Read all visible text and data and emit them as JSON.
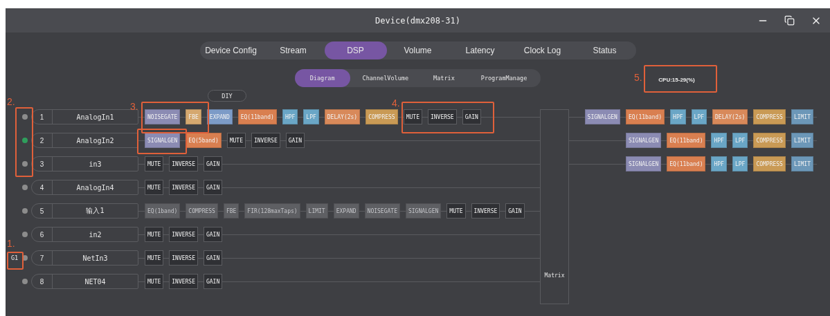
{
  "window": {
    "title": "Device(dmx208-31)"
  },
  "tabs": [
    {
      "label": "Device Config",
      "selected": false
    },
    {
      "label": "Stream",
      "selected": false
    },
    {
      "label": "DSP",
      "selected": true
    },
    {
      "label": "Volume",
      "selected": false
    },
    {
      "label": "Latency",
      "selected": false
    },
    {
      "label": "Clock Log",
      "selected": false
    },
    {
      "label": "Status",
      "selected": false
    }
  ],
  "subtabs": [
    {
      "label": "Diagram",
      "selected": true
    },
    {
      "label": "ChannelVolume",
      "selected": false
    },
    {
      "label": "Matrix",
      "selected": false
    },
    {
      "label": "ProgramManage",
      "selected": false
    }
  ],
  "cpu": "CPU:15-29(%)",
  "diy_button": "DIY",
  "channels": [
    {
      "number": "1",
      "name": "AnalogIn1",
      "active": false,
      "modules": [
        {
          "label": "NOISEGATE",
          "kind": "noisegate",
          "disabled": false
        },
        {
          "label": "FBE",
          "kind": "fbe",
          "disabled": false
        },
        {
          "label": "EXPAND",
          "kind": "expand",
          "disabled": false
        },
        {
          "label": "EQ(11band)",
          "kind": "eq",
          "disabled": false
        },
        {
          "label": "HPF",
          "kind": "filter",
          "disabled": false
        },
        {
          "label": "LPF",
          "kind": "filter",
          "disabled": false
        },
        {
          "label": "DELAY(2s)",
          "kind": "delay",
          "disabled": false
        },
        {
          "label": "COMPRESS",
          "kind": "compress",
          "disabled": false
        },
        {
          "label": "MUTE",
          "kind": "basic",
          "disabled": false
        },
        {
          "label": "INVERSE",
          "kind": "basic",
          "disabled": false
        },
        {
          "label": "GAIN",
          "kind": "basic",
          "disabled": false
        }
      ]
    },
    {
      "number": "2",
      "name": "AnalogIn2",
      "active": true,
      "modules": [
        {
          "label": "SIGNALGEN",
          "kind": "signalgen",
          "disabled": false
        },
        {
          "label": "EQ(5band)",
          "kind": "eq",
          "disabled": false
        },
        {
          "label": "MUTE",
          "kind": "basic",
          "disabled": false
        },
        {
          "label": "INVERSE",
          "kind": "basic",
          "disabled": false
        },
        {
          "label": "GAIN",
          "kind": "basic",
          "disabled": false
        }
      ]
    },
    {
      "number": "3",
      "name": "in3",
      "active": false,
      "modules": [
        {
          "label": "MUTE",
          "kind": "basic",
          "disabled": false
        },
        {
          "label": "INVERSE",
          "kind": "basic",
          "disabled": false
        },
        {
          "label": "GAIN",
          "kind": "basic",
          "disabled": false
        }
      ]
    },
    {
      "number": "4",
      "name": "AnalogIn4",
      "active": false,
      "modules": [
        {
          "label": "MUTE",
          "kind": "basic",
          "disabled": false
        },
        {
          "label": "INVERSE",
          "kind": "basic",
          "disabled": false
        },
        {
          "label": "GAIN",
          "kind": "basic",
          "disabled": false
        }
      ]
    },
    {
      "number": "5",
      "name": "输入1",
      "active": false,
      "modules": [
        {
          "label": "EQ(1band)",
          "kind": "eq",
          "disabled": true
        },
        {
          "label": "COMPRESS",
          "kind": "compress",
          "disabled": true
        },
        {
          "label": "FBE",
          "kind": "fbe",
          "disabled": true
        },
        {
          "label": "FIR(128maxTaps)",
          "kind": "fir",
          "disabled": true
        },
        {
          "label": "LIMIT",
          "kind": "limit",
          "disabled": true
        },
        {
          "label": "EXPAND",
          "kind": "expand",
          "disabled": true
        },
        {
          "label": "NOISEGATE",
          "kind": "noisegate",
          "disabled": true
        },
        {
          "label": "SIGNALGEN",
          "kind": "signalgen",
          "disabled": true
        },
        {
          "label": "MUTE",
          "kind": "basic",
          "disabled": false
        },
        {
          "label": "INVERSE",
          "kind": "basic",
          "disabled": false
        },
        {
          "label": "GAIN",
          "kind": "basic",
          "disabled": false
        }
      ]
    },
    {
      "number": "6",
      "name": "in2",
      "active": false,
      "modules": [
        {
          "label": "MUTE",
          "kind": "basic",
          "disabled": false
        },
        {
          "label": "INVERSE",
          "kind": "basic",
          "disabled": false
        },
        {
          "label": "GAIN",
          "kind": "basic",
          "disabled": false
        }
      ]
    },
    {
      "number": "7",
      "name": "NetIn3",
      "active": false,
      "group": "G1",
      "modules": [
        {
          "label": "MUTE",
          "kind": "basic",
          "disabled": false
        },
        {
          "label": "INVERSE",
          "kind": "basic",
          "disabled": false
        },
        {
          "label": "GAIN",
          "kind": "basic",
          "disabled": false
        }
      ]
    },
    {
      "number": "8",
      "name": "NET04",
      "active": false,
      "modules": [
        {
          "label": "MUTE",
          "kind": "basic",
          "disabled": false
        },
        {
          "label": "INVERSE",
          "kind": "basic",
          "disabled": false
        },
        {
          "label": "GAIN",
          "kind": "basic",
          "disabled": false
        }
      ]
    }
  ],
  "matrix": {
    "label": "Matrix"
  },
  "outputs": [
    {
      "modules": [
        {
          "label": "SIGNALGEN",
          "kind": "signalgen",
          "disabled": false
        },
        {
          "label": "EQ(11band)",
          "kind": "eq",
          "disabled": false
        },
        {
          "label": "HPF",
          "kind": "filter",
          "disabled": false
        },
        {
          "label": "LPF",
          "kind": "filter",
          "disabled": false
        },
        {
          "label": "DELAY(2s)",
          "kind": "delay",
          "disabled": false
        },
        {
          "label": "COMPRESS",
          "kind": "compress",
          "disabled": false
        },
        {
          "label": "LIMIT",
          "kind": "limit",
          "disabled": false
        }
      ]
    },
    {
      "modules": [
        {
          "label": "SIGNALGEN",
          "kind": "signalgen",
          "disabled": false
        },
        {
          "label": "EQ(11band)",
          "kind": "eq",
          "disabled": false
        },
        {
          "label": "HPF",
          "kind": "filter",
          "disabled": false
        },
        {
          "label": "LPF",
          "kind": "filter",
          "disabled": false
        },
        {
          "label": "COMPRESS",
          "kind": "compress",
          "disabled": false
        },
        {
          "label": "LIMIT",
          "kind": "limit",
          "disabled": false
        }
      ]
    },
    {
      "modules": [
        {
          "label": "SIGNALGEN",
          "kind": "signalgen",
          "disabled": false
        },
        {
          "label": "EQ(11band)",
          "kind": "eq",
          "disabled": false
        },
        {
          "label": "HPF",
          "kind": "filter",
          "disabled": false
        },
        {
          "label": "LPF",
          "kind": "filter",
          "disabled": false
        },
        {
          "label": "COMPRESS",
          "kind": "compress",
          "disabled": false
        },
        {
          "label": "LIMIT",
          "kind": "limit",
          "disabled": false
        }
      ]
    }
  ],
  "annotations": [
    {
      "label": "1."
    },
    {
      "label": "2."
    },
    {
      "label": "3."
    },
    {
      "label": "4."
    },
    {
      "label": "5."
    }
  ]
}
